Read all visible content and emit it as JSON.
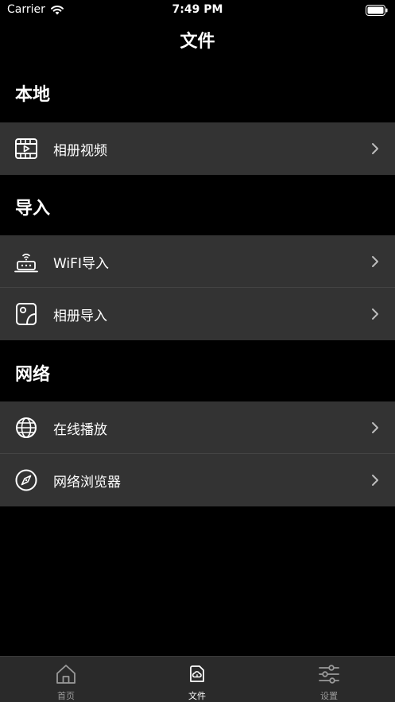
{
  "status_bar": {
    "carrier": "Carrier",
    "time": "7:49 PM"
  },
  "nav": {
    "title": "文件"
  },
  "sections": [
    {
      "header": "本地",
      "items": [
        {
          "label": "相册视频",
          "icon": "video-film-icon"
        }
      ]
    },
    {
      "header": "导入",
      "items": [
        {
          "label": "WiFI导入",
          "icon": "wifi-router-icon"
        },
        {
          "label": "相册导入",
          "icon": "photo-album-icon"
        }
      ]
    },
    {
      "header": "网络",
      "items": [
        {
          "label": "在线播放",
          "icon": "globe-icon"
        },
        {
          "label": "网络浏览器",
          "icon": "compass-icon"
        }
      ]
    }
  ],
  "tab_bar": {
    "tabs": [
      {
        "label": "首页",
        "icon": "home-icon",
        "active": false
      },
      {
        "label": "文件",
        "icon": "cloud-file-icon",
        "active": true
      },
      {
        "label": "设置",
        "icon": "sliders-icon",
        "active": false
      }
    ]
  },
  "colors": {
    "background": "#000000",
    "row_background": "#333333",
    "tab_bar_background": "#2a2a2a",
    "inactive_tab": "#9a9a9a",
    "active_tab": "#ffffff"
  }
}
